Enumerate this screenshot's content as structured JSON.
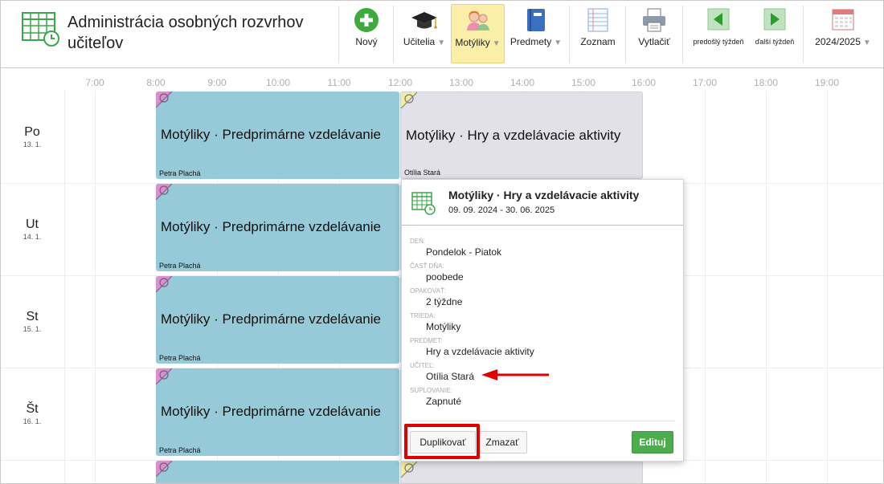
{
  "app": {
    "title": "Administrácia osobných rozvrhov učiteľov"
  },
  "toolbar": {
    "new_label": "Nový",
    "teachers_label": "Učitelia",
    "classes_label": "Motýliky",
    "subjects_label": "Predmety",
    "list_label": "Zoznam",
    "print_label": "Vytlačiť",
    "prev_week_label": "predošlý týždeň",
    "next_week_label": "ďalší týždeň",
    "year_label": "2024/2025"
  },
  "grid": {
    "hours": [
      "7:00",
      "8:00",
      "9:00",
      "10:00",
      "11:00",
      "12:00",
      "13:00",
      "14:00",
      "15:00",
      "16:00",
      "17:00",
      "18:00",
      "19:00"
    ],
    "days": [
      {
        "name": "Po",
        "date": "13. 1."
      },
      {
        "name": "Ut",
        "date": "14. 1."
      },
      {
        "name": "St",
        "date": "15. 1."
      },
      {
        "name": "Št",
        "date": "16. 1."
      }
    ],
    "lessons": {
      "morning_title": "Motýliky · Predprimárne vzdelávanie",
      "morning_teacher": "Petra Plachá",
      "afternoon_title": "Motýliky · Hry a vzdelávacie aktivity",
      "afternoon_teacher": "Otília Stará"
    }
  },
  "popup": {
    "title": "Motýliky · Hry a vzdelávacie aktivity",
    "dates": "09. 09. 2024 - 30. 06. 2025",
    "fields": [
      {
        "label": "Deň:",
        "value": "Pondelok - Piatok"
      },
      {
        "label": "Časť dňa:",
        "value": "poobede"
      },
      {
        "label": "Opakovať:",
        "value": "2 týždne"
      },
      {
        "label": "Trieda:",
        "value": "Motýliky"
      },
      {
        "label": "Predmet:",
        "value": "Hry a vzdelávacie aktivity"
      },
      {
        "label": "Učiteľ:",
        "value": "Otília Stará"
      },
      {
        "label": "Suplovanie:",
        "value": "Zapnuté"
      }
    ],
    "duplicate_label": "Duplikovať",
    "delete_label": "Zmazať",
    "edit_label": "Edituj"
  },
  "colors": {
    "morning_lesson": "#96cad9",
    "afternoon_lesson": "#e2e1e8",
    "active_tab": "#fbeea9",
    "edit_button": "#4cad4c",
    "highlight": "#e10000"
  }
}
